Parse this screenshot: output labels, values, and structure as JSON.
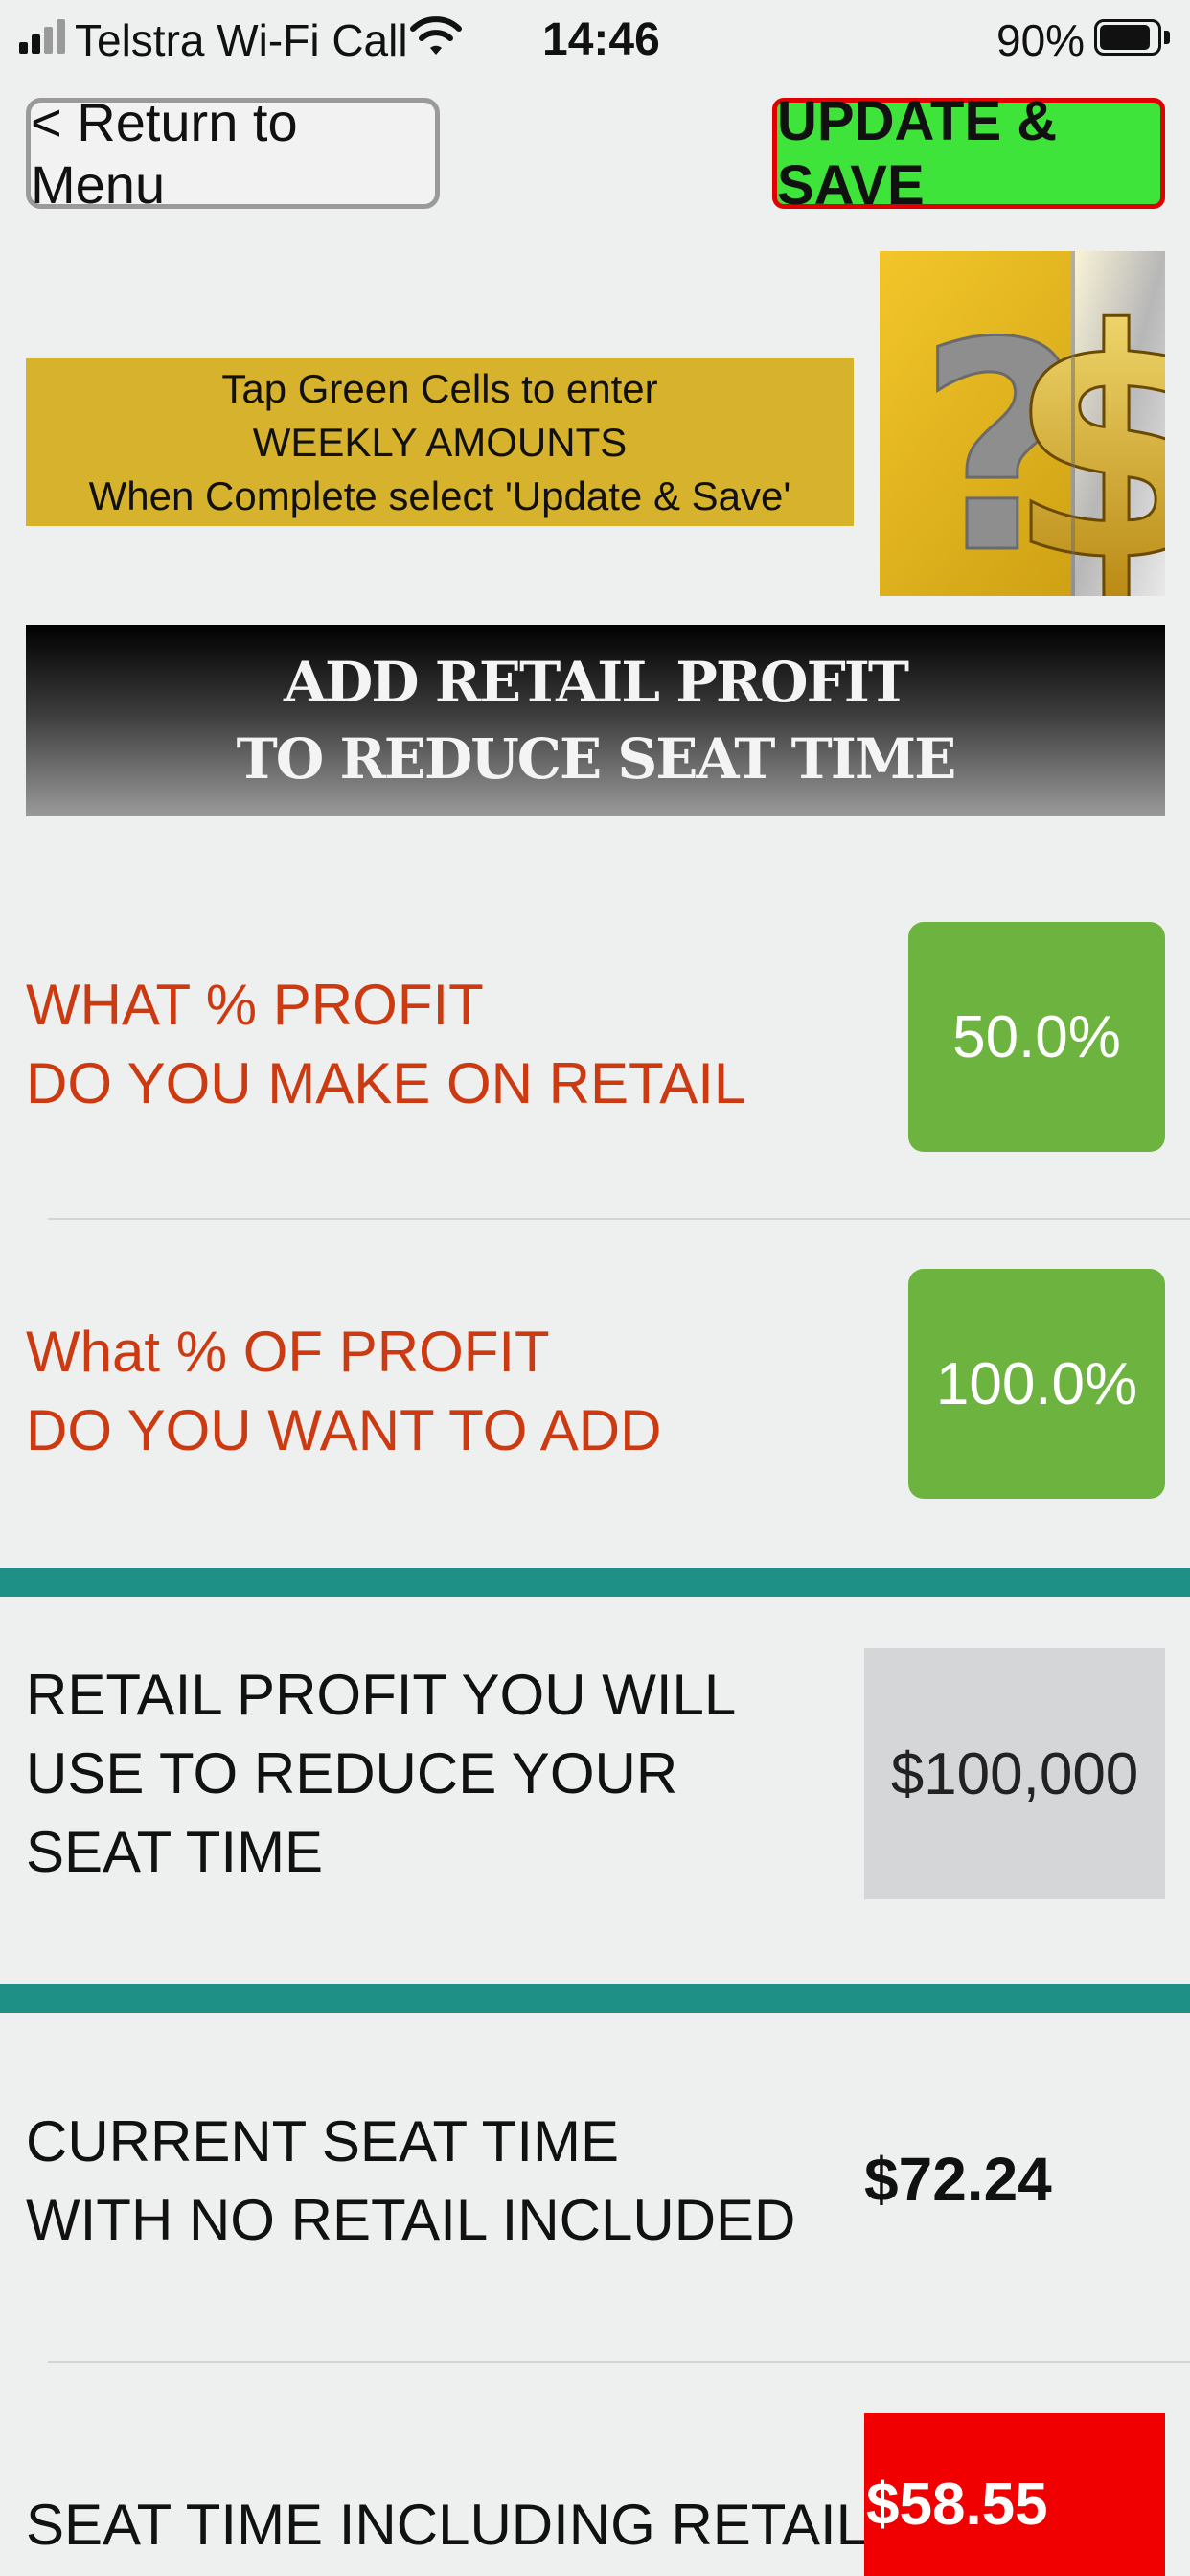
{
  "status_bar": {
    "carrier": "Telstra Wi-Fi Call",
    "time": "14:46",
    "battery_percent": "90%",
    "battery_level": 0.9
  },
  "header": {
    "menu_button": "< Return to Menu",
    "save_button": "UPDATE & SAVE"
  },
  "instructions": {
    "line1": "Tap Green Cells to enter",
    "line2": "WEEKLY AMOUNTS",
    "line3": "When Complete select 'Update & Save'"
  },
  "banner": {
    "line1": "ADD RETAIL PROFIT",
    "line2": "TO REDUCE SEAT TIME"
  },
  "questions": [
    {
      "line1": "WHAT % PROFIT",
      "line2": "DO YOU MAKE ON RETAIL",
      "value": "50.0%"
    },
    {
      "line1": "What % OF PROFIT",
      "line2": "DO YOU WANT TO ADD",
      "value": "100.0%"
    }
  ],
  "results": {
    "retail_profit": {
      "line1": "RETAIL PROFIT YOU WILL",
      "line2": "USE TO REDUCE YOUR",
      "line3": "SEAT TIME",
      "value": "$100,000"
    },
    "current_seat_time": {
      "line1": "CURRENT SEAT TIME",
      "line2": "WITH NO RETAIL INCLUDED",
      "value": "$72.24"
    },
    "seat_time_including_retail": {
      "label": "SEAT TIME INCLUDING RETAIL",
      "value": "$58.55"
    }
  },
  "colors": {
    "background": "#eeefef",
    "save_green": "#3fe43a",
    "save_border": "#e00000",
    "instruction_gold": "#d7b22c",
    "question_orange": "#cc3a12",
    "input_green": "#6db33f",
    "teal_divider": "#1f9086",
    "result_red": "#f00000"
  }
}
